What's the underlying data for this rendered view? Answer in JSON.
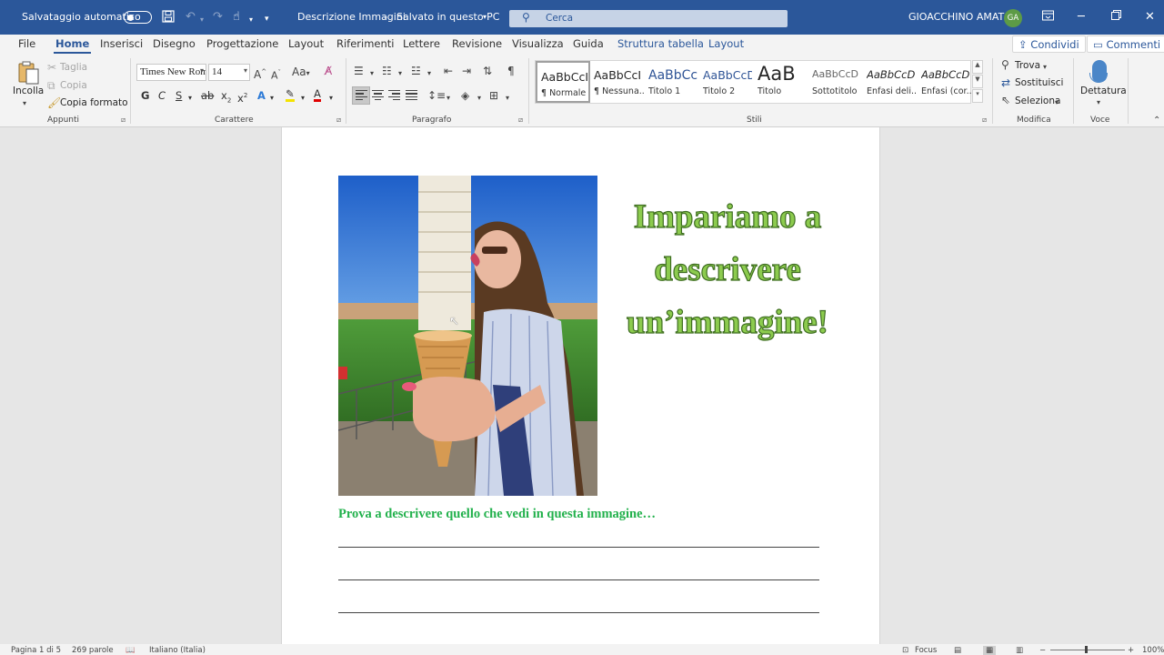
{
  "titlebar": {
    "autosave_label": "Salvataggio automatico",
    "doc_title": "Descrizione Immagini",
    "save_status": "Salvato in questo PC",
    "search_placeholder": "Cerca",
    "user_name": "GIOACCHINO AMATO",
    "user_initials": "GA",
    "accent_color": "#2b579a"
  },
  "tabs": {
    "file": "File",
    "home": "Home",
    "insert": "Inserisci",
    "draw": "Disegno",
    "design": "Progettazione",
    "layout": "Layout",
    "references": "Riferimenti",
    "mailings": "Lettere",
    "review": "Revisione",
    "view": "Visualizza",
    "help": "Guida",
    "table_design": "Struttura tabella",
    "table_layout": "Layout",
    "share": "Condividi",
    "comments": "Commenti"
  },
  "ribbon": {
    "clipboard": {
      "paste": "Incolla",
      "cut": "Taglia",
      "copy": "Copia",
      "format_painter": "Copia formato",
      "label": "Appunti"
    },
    "font": {
      "family": "Times New Roman",
      "size": "14",
      "label": "Carattere"
    },
    "paragraph": {
      "label": "Paragrafo"
    },
    "styles": {
      "label": "Stili",
      "items": [
        {
          "sample": "AaBbCcI",
          "name": "¶ Normale"
        },
        {
          "sample": "AaBbCcI",
          "name": "¶ Nessuna..."
        },
        {
          "sample": "AaBbCc",
          "name": "Titolo 1"
        },
        {
          "sample": "AaBbCcD",
          "name": "Titolo 2"
        },
        {
          "sample": "AaB",
          "name": "Titolo"
        },
        {
          "sample": "AaBbCcD",
          "name": "Sottotitolo"
        },
        {
          "sample": "AaBbCcD",
          "name": "Enfasi deli..."
        },
        {
          "sample": "AaBbCcD",
          "name": "Enfasi (cor..."
        }
      ]
    },
    "editing": {
      "find": "Trova",
      "replace": "Sostituisci",
      "select": "Seleziona",
      "label": "Modifica"
    },
    "voice": {
      "dictate": "Dettatura",
      "label": "Voce"
    }
  },
  "document": {
    "heading": "Impariamo a descrivere un’immagine!",
    "prompt": "Prova a descrivere quello che vedi in questa immagine…",
    "heading_color": "#8ccb4e",
    "prompt_color": "#22b14c"
  },
  "statusbar": {
    "page": "Pagina 1 di 5",
    "words": "269 parole",
    "language": "Italiano (Italia)",
    "focus": "Focus",
    "zoom": "100%"
  }
}
